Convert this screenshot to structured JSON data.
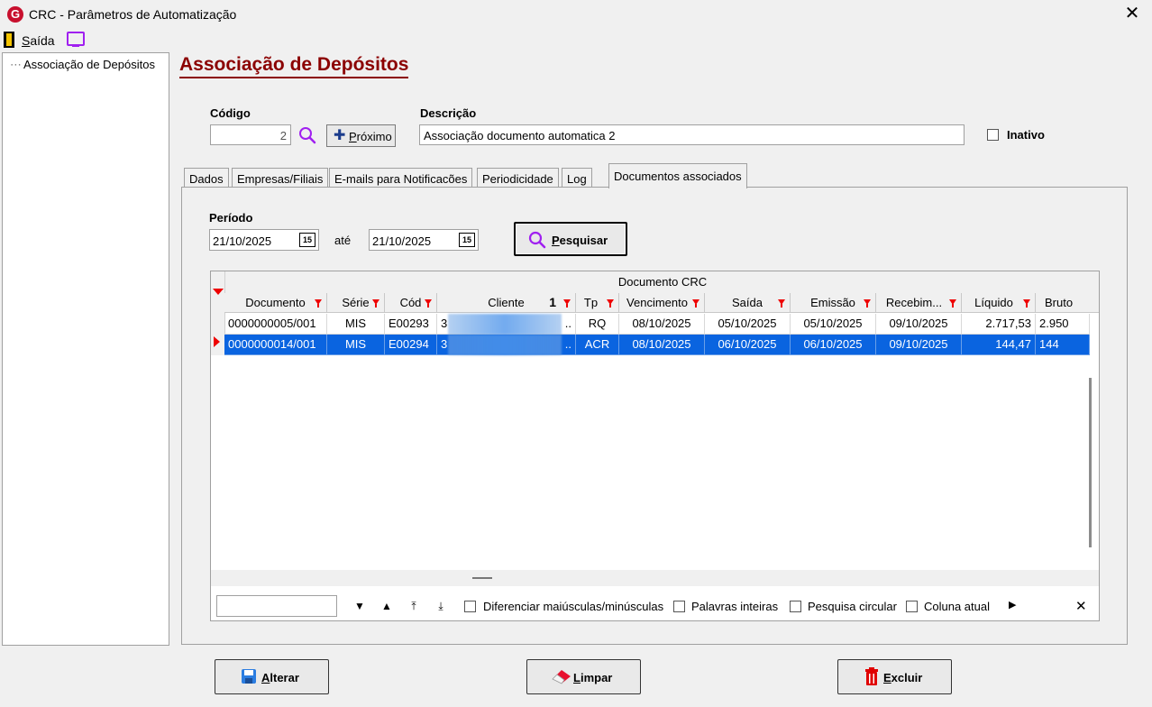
{
  "window": {
    "title": "CRC - Parâmetros de Automatização",
    "close_glyph": "✕"
  },
  "menu": {
    "exit_label_first": "S",
    "exit_label_rest": "aída"
  },
  "tree": {
    "items": [
      {
        "label": "Associação de Depósitos"
      }
    ]
  },
  "page": {
    "title": "Associação de Depósitos"
  },
  "form": {
    "codigo_label": "Código",
    "codigo_value": "2",
    "next_label_first": "P",
    "next_label_rest": "róximo",
    "descricao_label": "Descrição",
    "descricao_value": "Associação documento automatica 2",
    "inactive_label": "Inativo",
    "inactive_checked": false
  },
  "tabs": [
    {
      "label": "Dados"
    },
    {
      "label": "Empresas/Filiais"
    },
    {
      "label": "E-mails para Notificacões"
    },
    {
      "label": "Periodicidade"
    },
    {
      "label": "Log"
    },
    {
      "label": "Documentos associados",
      "active": true
    }
  ],
  "filter": {
    "periodo_label": "Período",
    "date_from": "21/10/2025",
    "ate_label": "até",
    "date_to": "21/10/2025",
    "calendar_glyph": "15",
    "search_label_first": "P",
    "search_label_rest": "esquisar"
  },
  "grid": {
    "group_header": "Documento CRC",
    "columns": [
      "Documento",
      "Série",
      "Cód",
      "Cliente",
      "Tp",
      "Vencimento",
      "Saída",
      "Emissão",
      "Recebim...",
      "Líquido",
      "Bruto"
    ],
    "client_sort_glyph": "1",
    "rows": [
      {
        "documento": "0000000005/001",
        "serie": "MIS",
        "cod": "E00293",
        "cliente": "3",
        "cliente_tail": "..",
        "tp": "RQ",
        "vencimento": "08/10/2025",
        "saida": "05/10/2025",
        "emissao": "05/10/2025",
        "recebimento": "09/10/2025",
        "liquido": "2.717,53",
        "bruto": "2.950",
        "selected": false
      },
      {
        "documento": "0000000014/001",
        "serie": "MIS",
        "cod": "E00294",
        "cliente": "3",
        "cliente_tail": "..",
        "tp": "ACR",
        "vencimento": "08/10/2025",
        "saida": "06/10/2025",
        "emissao": "06/10/2025",
        "recebimento": "09/10/2025",
        "liquido": "144,47",
        "bruto": "144",
        "selected": true
      }
    ]
  },
  "findbar": {
    "search_value": "",
    "nav": [
      "▼",
      "▲",
      "⤒",
      "⤓"
    ],
    "case_label": "Diferenciar maiúsculas/minúsculas",
    "whole_words_label": "Palavras inteiras",
    "circular_label": "Pesquisa circular",
    "current_col_label": "Coluna atual",
    "more_glyph": "▶",
    "close_glyph": "✕"
  },
  "buttons": {
    "alterar_first": "A",
    "alterar_rest": "lterar",
    "limpar_first": "L",
    "limpar_rest": "impar",
    "excluir_first": "E",
    "excluir_rest": "xcluir"
  },
  "colors": {
    "accent_title": "#8b0000",
    "selection": "#0a64e0",
    "filter_red": "#e00000",
    "search_icon": "#a020f0"
  }
}
